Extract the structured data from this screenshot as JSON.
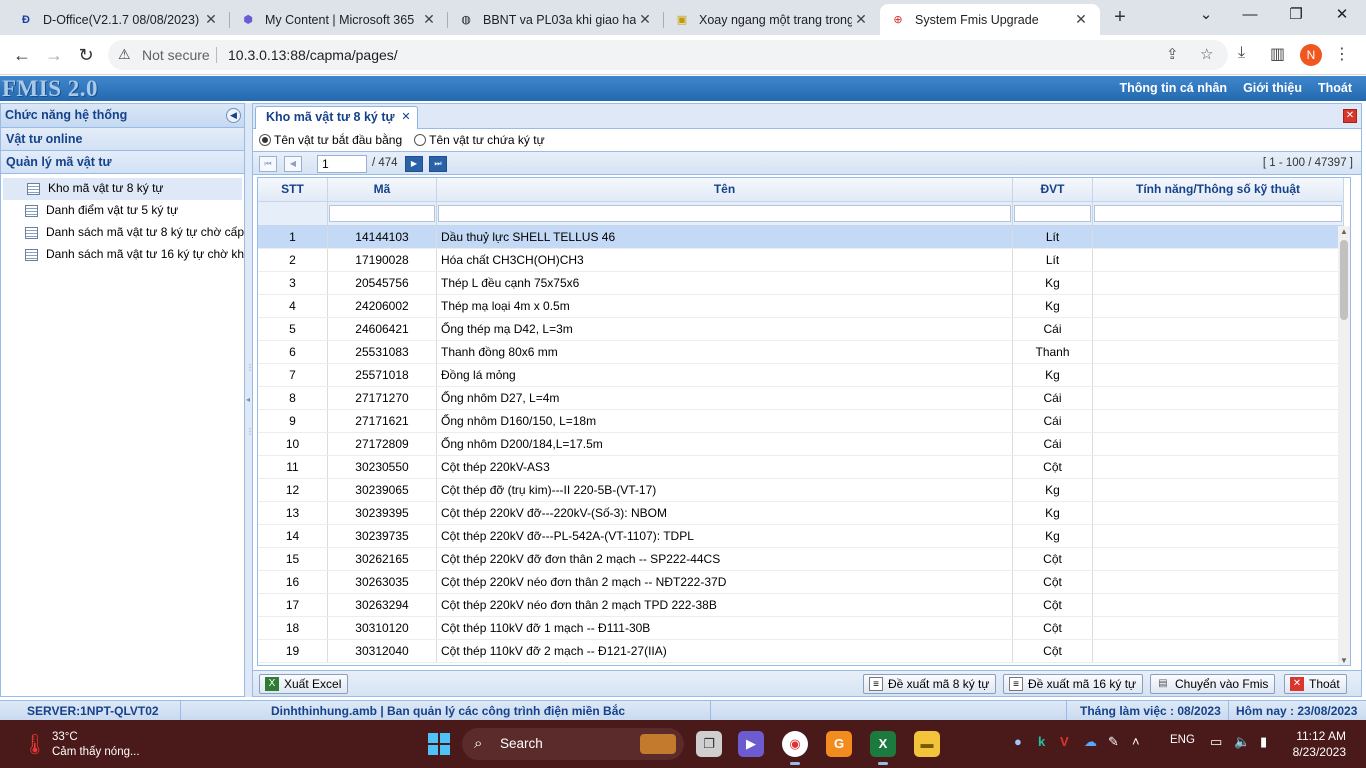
{
  "browser": {
    "tabs": [
      {
        "title": "D-Office(V2.1.7 08/08/2023)",
        "icon": "d-office-icon",
        "active": false
      },
      {
        "title": "My Content | Microsoft 365",
        "icon": "microsoft-365-icon",
        "active": false
      },
      {
        "title": "BBNT va PL03a khi giao hang",
        "icon": "globe-icon",
        "active": false
      },
      {
        "title": "Xoay ngang một trang trong",
        "icon": "lock-doc-icon",
        "active": false
      },
      {
        "title": "System Fmis Upgrade",
        "icon": "evn-icon",
        "active": true
      }
    ],
    "security": "Not secure",
    "url": "10.3.0.13:88/capma/pages/",
    "profile_initial": "N"
  },
  "app": {
    "logo": "FMIS 2.0",
    "top_links": [
      "Thông tin cá nhân",
      "Giới thiệu",
      "Thoát"
    ]
  },
  "left": {
    "title": "Chức năng hệ thống",
    "sections": [
      "Vật tư online",
      "Quản lý mã vật tư"
    ],
    "items": [
      "Kho mã vật tư 8 ký tự",
      "Danh điểm vật tư 5 ký tự",
      "Danh sách mã vật tư 8 ký tự chờ cấp",
      "Danh sách mã vật tư 16 ký tự chờ kh"
    ]
  },
  "main": {
    "tab_title": "Kho mã vật tư 8 ký tự",
    "radio_1": "Tên vật tư bắt đầu bằng",
    "radio_2": "Tên vật tư chứa ký tự",
    "pager": {
      "page": "1",
      "total": "/ 474",
      "range": "[ 1 - 100 / 47397 ]"
    },
    "columns": [
      "STT",
      "Mã",
      "Tên",
      "ĐVT",
      "Tính năng/Thông số kỹ thuật"
    ],
    "rows": [
      [
        "1",
        "14144103",
        "Dầu thuỷ lực SHELL TELLUS 46",
        "Lít"
      ],
      [
        "2",
        "17190028",
        "Hóa chất CH3CH(OH)CH3",
        "Lít"
      ],
      [
        "3",
        "20545756",
        "Thép L đều cạnh 75x75x6",
        "Kg"
      ],
      [
        "4",
        "24206002",
        "Thép mạ loại 4m x 0.5m",
        "Kg"
      ],
      [
        "5",
        "24606421",
        "Ống thép mạ D42, L=3m",
        "Cái"
      ],
      [
        "6",
        "25531083",
        "Thanh đồng 80x6 mm",
        "Thanh"
      ],
      [
        "7",
        "25571018",
        "Đồng lá mỏng",
        "Kg"
      ],
      [
        "8",
        "27171270",
        "Ống nhôm D27, L=4m",
        "Cái"
      ],
      [
        "9",
        "27171621",
        "Ống nhôm D160/150, L=18m",
        "Cái"
      ],
      [
        "10",
        "27172809",
        "Ống nhôm D200/184,L=17.5m",
        "Cái"
      ],
      [
        "11",
        "30230550",
        "Cột thép 220kV-AS3",
        "Cột"
      ],
      [
        "12",
        "30239065",
        "Cột thép đỡ (trụ kim)---II 220-5B-(VT-17)",
        "Kg"
      ],
      [
        "13",
        "30239395",
        "Cột thép 220kV đỡ---220kV-(Số-3): NBOM",
        "Kg"
      ],
      [
        "14",
        "30239735",
        "Cột thép 220kV đỡ---PL-542A-(VT-1107): TDPL",
        "Kg"
      ],
      [
        "15",
        "30262165",
        "Cột thép 220kV đỡ đơn thân 2 mạch -- SP222-44CS",
        "Cột"
      ],
      [
        "16",
        "30263035",
        "Cột thép 220kV néo đơn thân 2 mạch -- NĐT222-37D",
        "Cột"
      ],
      [
        "17",
        "30263294",
        "Cột thép 220kV néo đơn thân 2 mạch TPD 222-38B",
        "Cột"
      ],
      [
        "18",
        "30310120",
        "Cột thép 110kV đỡ 1 mạch -- Đ111-30B",
        "Cột"
      ],
      [
        "19",
        "30312040",
        "Cột thép 110kV đỡ 2 mạch -- Đ121-27(IIA)",
        "Cột"
      ]
    ],
    "buttons": {
      "excel": "Xuất Excel",
      "propose8": "Đề xuất mã 8 ký tự",
      "propose16": "Đề xuất mã 16 ký tự",
      "transfer": "Chuyển vào Fmis",
      "exit": "Thoát"
    }
  },
  "status": {
    "server": "SERVER:1NPT-QLVT02",
    "user": "Dinhthinhung.amb | Ban quản lý các công trình điện miền Bắc",
    "work_month": "Tháng làm việc : 08/2023",
    "today": "Hôm nay : 23/08/2023"
  },
  "taskbar": {
    "temp": "33°C",
    "weather": "Cảm thấy nóng...",
    "search": "Search",
    "lang": "ENG",
    "time": "11:12 AM",
    "date": "8/23/2023"
  },
  "colors": {
    "accent": "#2469b0",
    "panel_border": "#99bbe8",
    "header_text": "#15428b",
    "selected_row": "#c3d9f5"
  }
}
